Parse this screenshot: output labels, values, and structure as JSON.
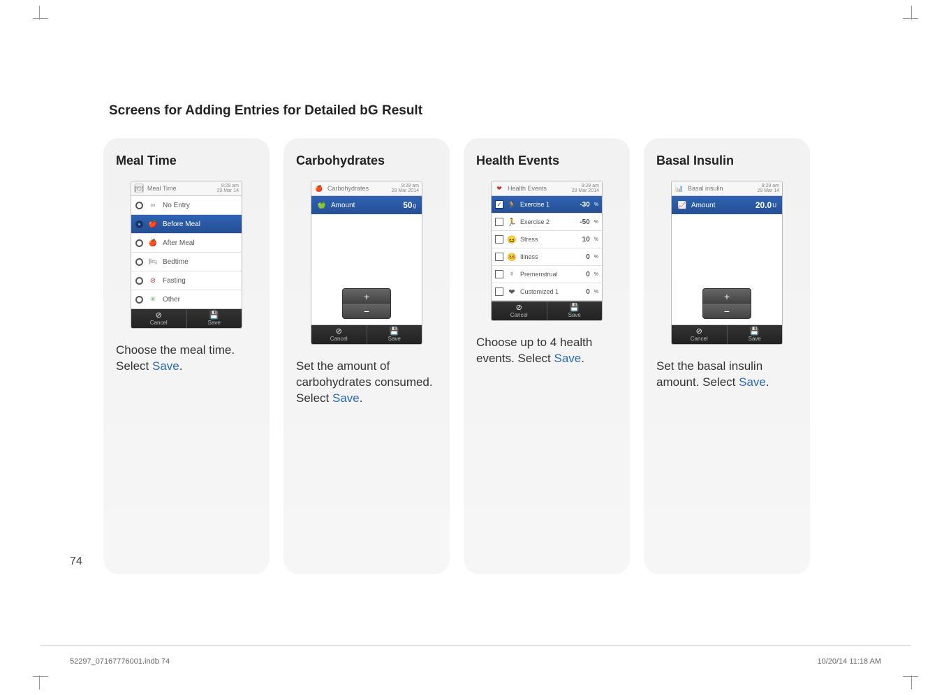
{
  "page": {
    "title": "Screens for Adding Entries for Detailed bG Result",
    "number": "74",
    "footer_file": "52297_07167776001.indb   74",
    "footer_date": "10/20/14   11:18 AM"
  },
  "common": {
    "time": "9:29 am",
    "date_short": "29 Mar 14",
    "date_long": "29 Mar 2014",
    "cancel": "Cancel",
    "save": "Save"
  },
  "mealtime": {
    "card_title": "Meal Time",
    "header": "Meal Time",
    "options": [
      {
        "label": "No Entry",
        "icon": "∞",
        "color": "#888",
        "selected": false
      },
      {
        "label": "Before Meal",
        "icon": "🍎",
        "color": "#d33",
        "selected": true
      },
      {
        "label": "After Meal",
        "icon": "🍎",
        "color": "#e90",
        "selected": false
      },
      {
        "label": "Bedtime",
        "icon": "🛏",
        "color": "#777",
        "selected": false
      },
      {
        "label": "Fasting",
        "icon": "⊘",
        "color": "#c33",
        "selected": false
      },
      {
        "label": "Other",
        "icon": "✳",
        "color": "#5a5",
        "selected": false
      }
    ],
    "caption_pre": "Choose the meal time. Select ",
    "caption_save": "Save",
    "caption_post": "."
  },
  "carbs": {
    "card_title": "Carbohydrates",
    "header": "Carbohydrates",
    "amount_label": "Amount",
    "amount_value": "50",
    "amount_unit": "g",
    "caption_pre": "Set the amount of carbohydrates consumed. Select ",
    "caption_save": "Save",
    "caption_post": "."
  },
  "health": {
    "card_title": "Health Events",
    "header": "Health Events",
    "rows": [
      {
        "label": "Exercise 1",
        "value": "-30",
        "unit": "%",
        "checked": true,
        "icon": "🏃",
        "selected": true
      },
      {
        "label": "Exercise 2",
        "value": "-50",
        "unit": "%",
        "checked": false,
        "icon": "🏃",
        "selected": false
      },
      {
        "label": "Stress",
        "value": "10",
        "unit": "%",
        "checked": false,
        "icon": "😖",
        "selected": false
      },
      {
        "label": "Illness",
        "value": "0",
        "unit": "%",
        "checked": false,
        "icon": "🤒",
        "selected": false
      },
      {
        "label": "Premenstrual",
        "value": "0",
        "unit": "%",
        "checked": false,
        "icon": "♀",
        "selected": false
      },
      {
        "label": "Customized 1",
        "value": "0",
        "unit": "%",
        "checked": false,
        "icon": "❤",
        "selected": false
      }
    ],
    "caption_pre": "Choose up to 4 health events. Select ",
    "caption_save": "Save",
    "caption_post": "."
  },
  "basal": {
    "card_title": "Basal Insulin",
    "header": "Basal insulin",
    "amount_label": "Amount",
    "amount_value": "20.0",
    "amount_unit": "U",
    "caption_pre": "Set the basal insulin amount. Select ",
    "caption_save": "Save",
    "caption_post": "."
  }
}
